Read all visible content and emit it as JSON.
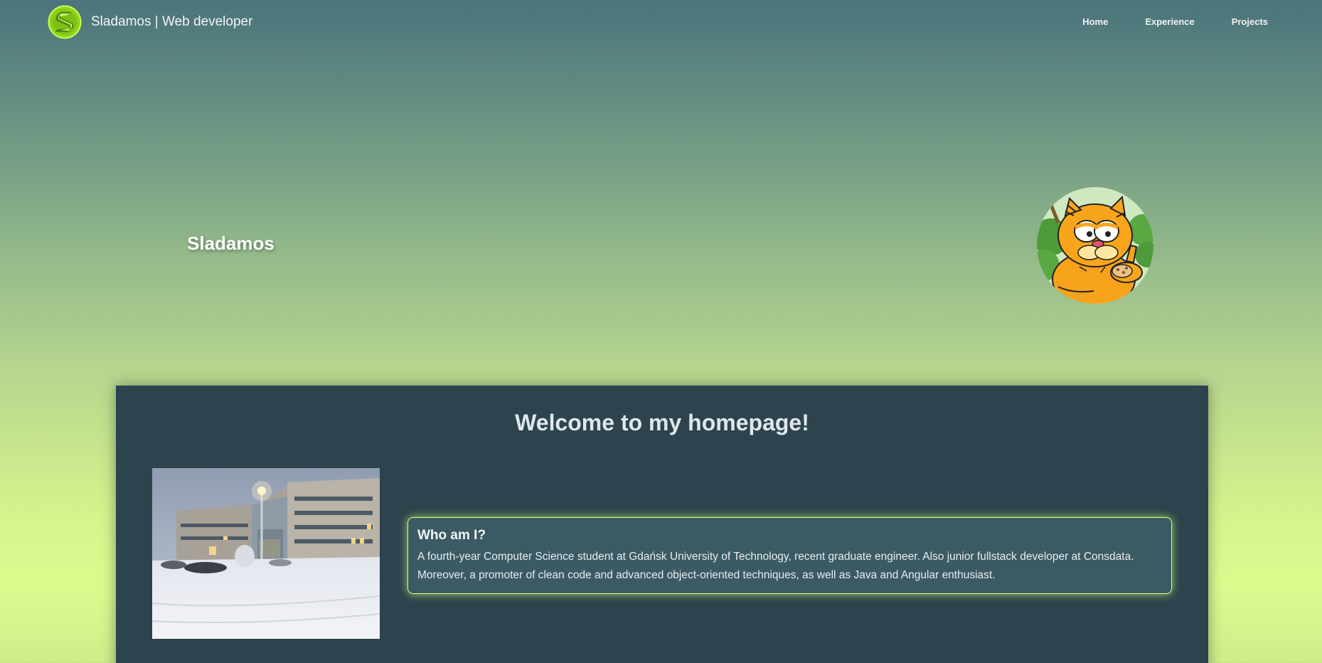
{
  "navbar": {
    "brand": "Sladamos | Web developer",
    "links": [
      {
        "label": "Home"
      },
      {
        "label": "Experience"
      },
      {
        "label": "Projects"
      }
    ]
  },
  "hero": {
    "name": "Sladamos"
  },
  "main": {
    "heading": "Welcome to my homepage!",
    "about": {
      "title": "Who am I?",
      "text": "A fourth-year Computer Science student at Gdańsk University of Technology, recent graduate engineer. Also junior fullstack developer at Consdata. Moreover, a promoter of clean code and advanced object-oriented techniques, as well as Java and Angular enthusiast."
    }
  },
  "colors": {
    "accent": "#d9ff86",
    "card_bg": "#2d434d",
    "about_bg": "#3b5a64"
  }
}
